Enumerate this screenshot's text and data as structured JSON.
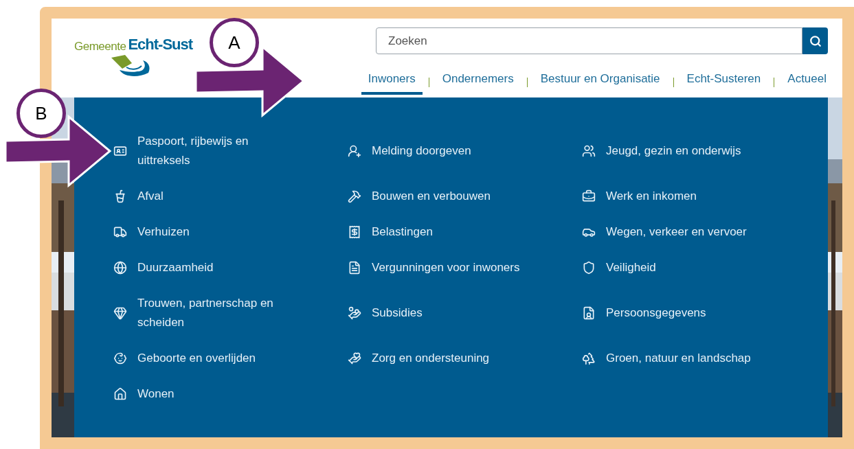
{
  "logo": {
    "prefix": "Gemeente",
    "name": "Echt-Sust"
  },
  "search": {
    "placeholder": "Zoeken"
  },
  "nav": [
    {
      "label": "Inwoners",
      "selected": true
    },
    {
      "label": "Ondernemers",
      "selected": false
    },
    {
      "label": "Bestuur en Organisatie",
      "selected": false
    },
    {
      "label": "Echt-Susteren",
      "selected": false
    },
    {
      "label": "Actueel",
      "selected": false
    }
  ],
  "menu": [
    "Paspoort, rijbewijs en uittreksels",
    "Melding doorgeven",
    "Jeugd, gezin en onderwijs",
    "Afval",
    "Bouwen en verbouwen",
    "Werk en inkomen",
    "Verhuizen",
    "Belastingen",
    "Wegen, verkeer en vervoer",
    "Duurzaamheid",
    "Vergunningen voor inwoners",
    "Veiligheid",
    "Trouwen, partnerschap en scheiden",
    "Subsidies",
    "Persoonsgegevens",
    "Geboorte en overlijden",
    "Zorg en ondersteuning",
    "Groen, natuur en landschap",
    "Wonen"
  ],
  "annotations": [
    {
      "label": "A"
    },
    {
      "label": "B"
    }
  ]
}
